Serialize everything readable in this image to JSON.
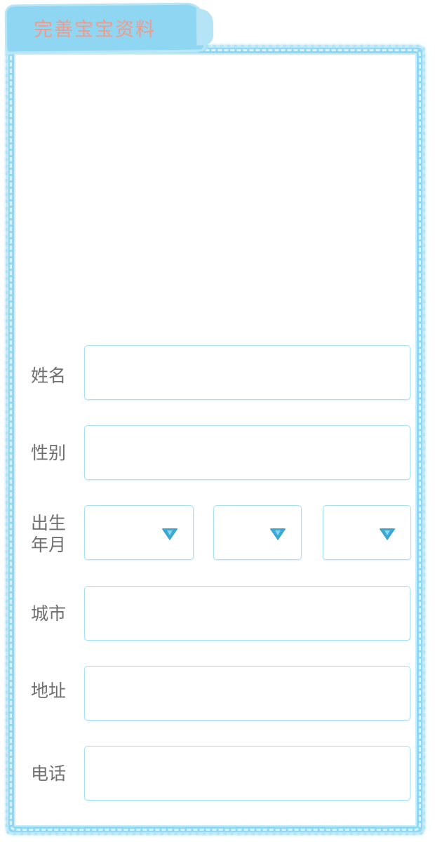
{
  "header": {
    "title": "完善宝宝资料"
  },
  "form": {
    "name": {
      "label": "姓名",
      "value": ""
    },
    "gender": {
      "label": "性别",
      "value": ""
    },
    "birth": {
      "label": "出生年月",
      "year": "",
      "month": "",
      "day": ""
    },
    "city": {
      "label": "城市",
      "value": ""
    },
    "address": {
      "label": "地址",
      "value": ""
    },
    "phone": {
      "label": "电话",
      "value": ""
    }
  },
  "colors": {
    "frame": "#8fd7f2",
    "title_text": "#f19a8a",
    "field_border": "#a8e1f4",
    "dropdown_arrow": "#3aa9d3",
    "label_text": "#6f6f6f"
  },
  "icons": {
    "dropdown": "triangle-down-icon"
  }
}
